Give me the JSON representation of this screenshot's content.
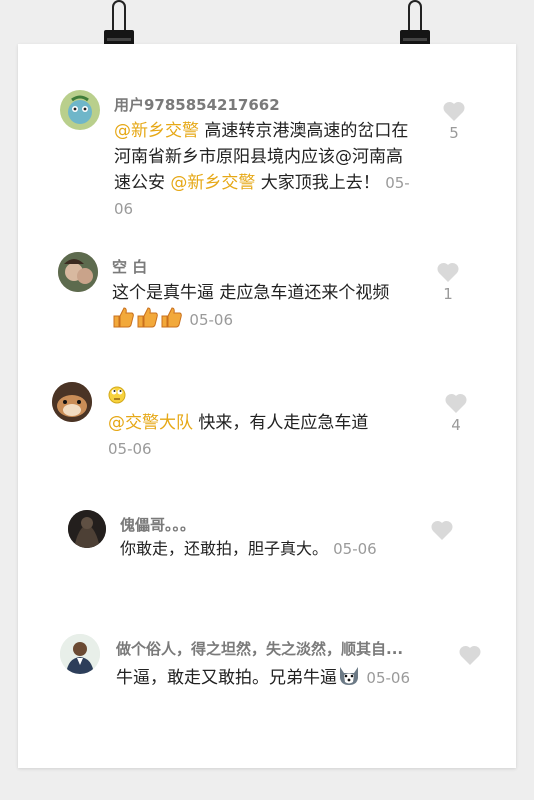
{
  "comments": [
    {
      "username": "用户9785854217662",
      "mention1": "@新乡交警",
      "text1": " 高速转京港澳高速的岔口在河南省新乡市原阳县境内应该@河南高速公安 ",
      "mention2": "@新乡交警",
      "text2": " 大家顶我上去！",
      "date": "05-06",
      "likes": "5",
      "avatar_icon": "cartoon-avatar"
    },
    {
      "username": "空 白",
      "text1": "这个是真牛逼 走应急车道还来个视频",
      "emoji": "thumbs-up x3",
      "date": "05-06",
      "likes": "1",
      "avatar_icon": "photo-avatar"
    },
    {
      "username_emoji": "rolling-eyes-emoji",
      "mention1": "@交警大队",
      "text1": " 快来，有人走应急车道",
      "date": "05-06",
      "likes": "4",
      "avatar_icon": "hamster-avatar"
    },
    {
      "username": "傀儡哥。。。",
      "text1": "你敢走，还敢拍，胆子真大。",
      "date": "05-06",
      "avatar_icon": "dark-photo-avatar"
    },
    {
      "username": "做个俗人，得之坦然，失之淡然，顺其自...",
      "text1": "牛逼，敢走又敢拍。兄弟牛逼",
      "emoji": "husky-emoji",
      "date": "05-06",
      "avatar_icon": "person-avatar"
    }
  ],
  "colors": {
    "mention": "#e6a817",
    "meta": "#9a9a9a",
    "heart": "#d9d9d9"
  }
}
